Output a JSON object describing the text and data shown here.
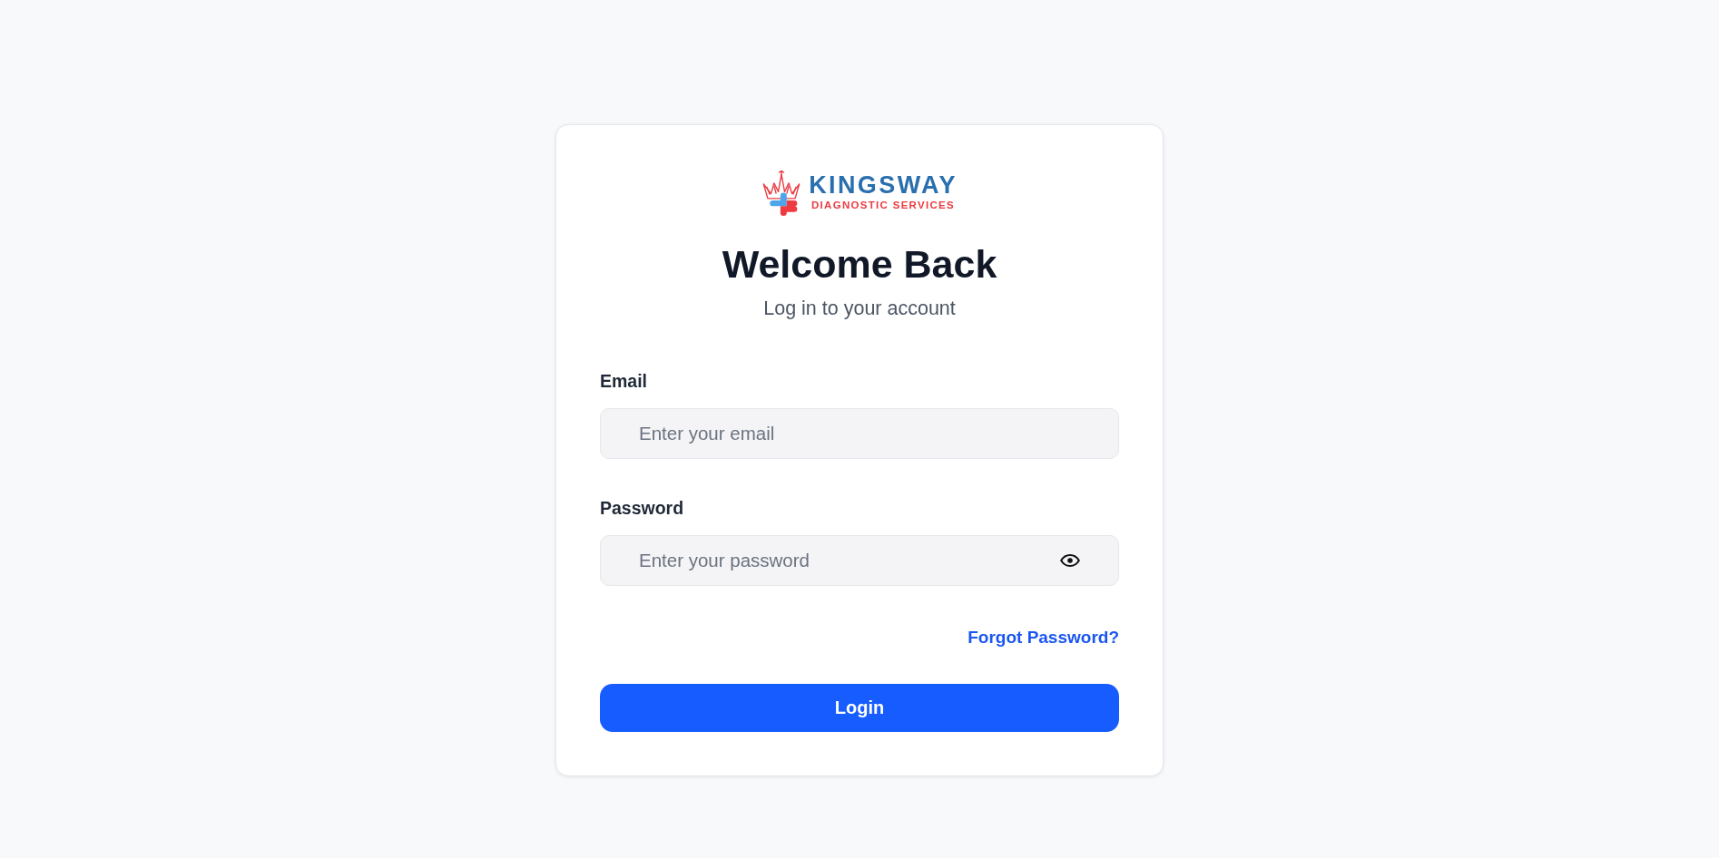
{
  "logo": {
    "name": "KINGSWAY",
    "tagline": "DIAGNOSTIC SERVICES"
  },
  "heading": {
    "title": "Welcome Back",
    "subtitle": "Log in to your account"
  },
  "fields": [
    {
      "kind": "email",
      "label": "Email",
      "placeholder": "Enter your email"
    },
    {
      "kind": "password",
      "label": "Password",
      "placeholder": "Enter your password"
    }
  ],
  "forgot_link": "Forgot Password?",
  "submit_button": "Login"
}
